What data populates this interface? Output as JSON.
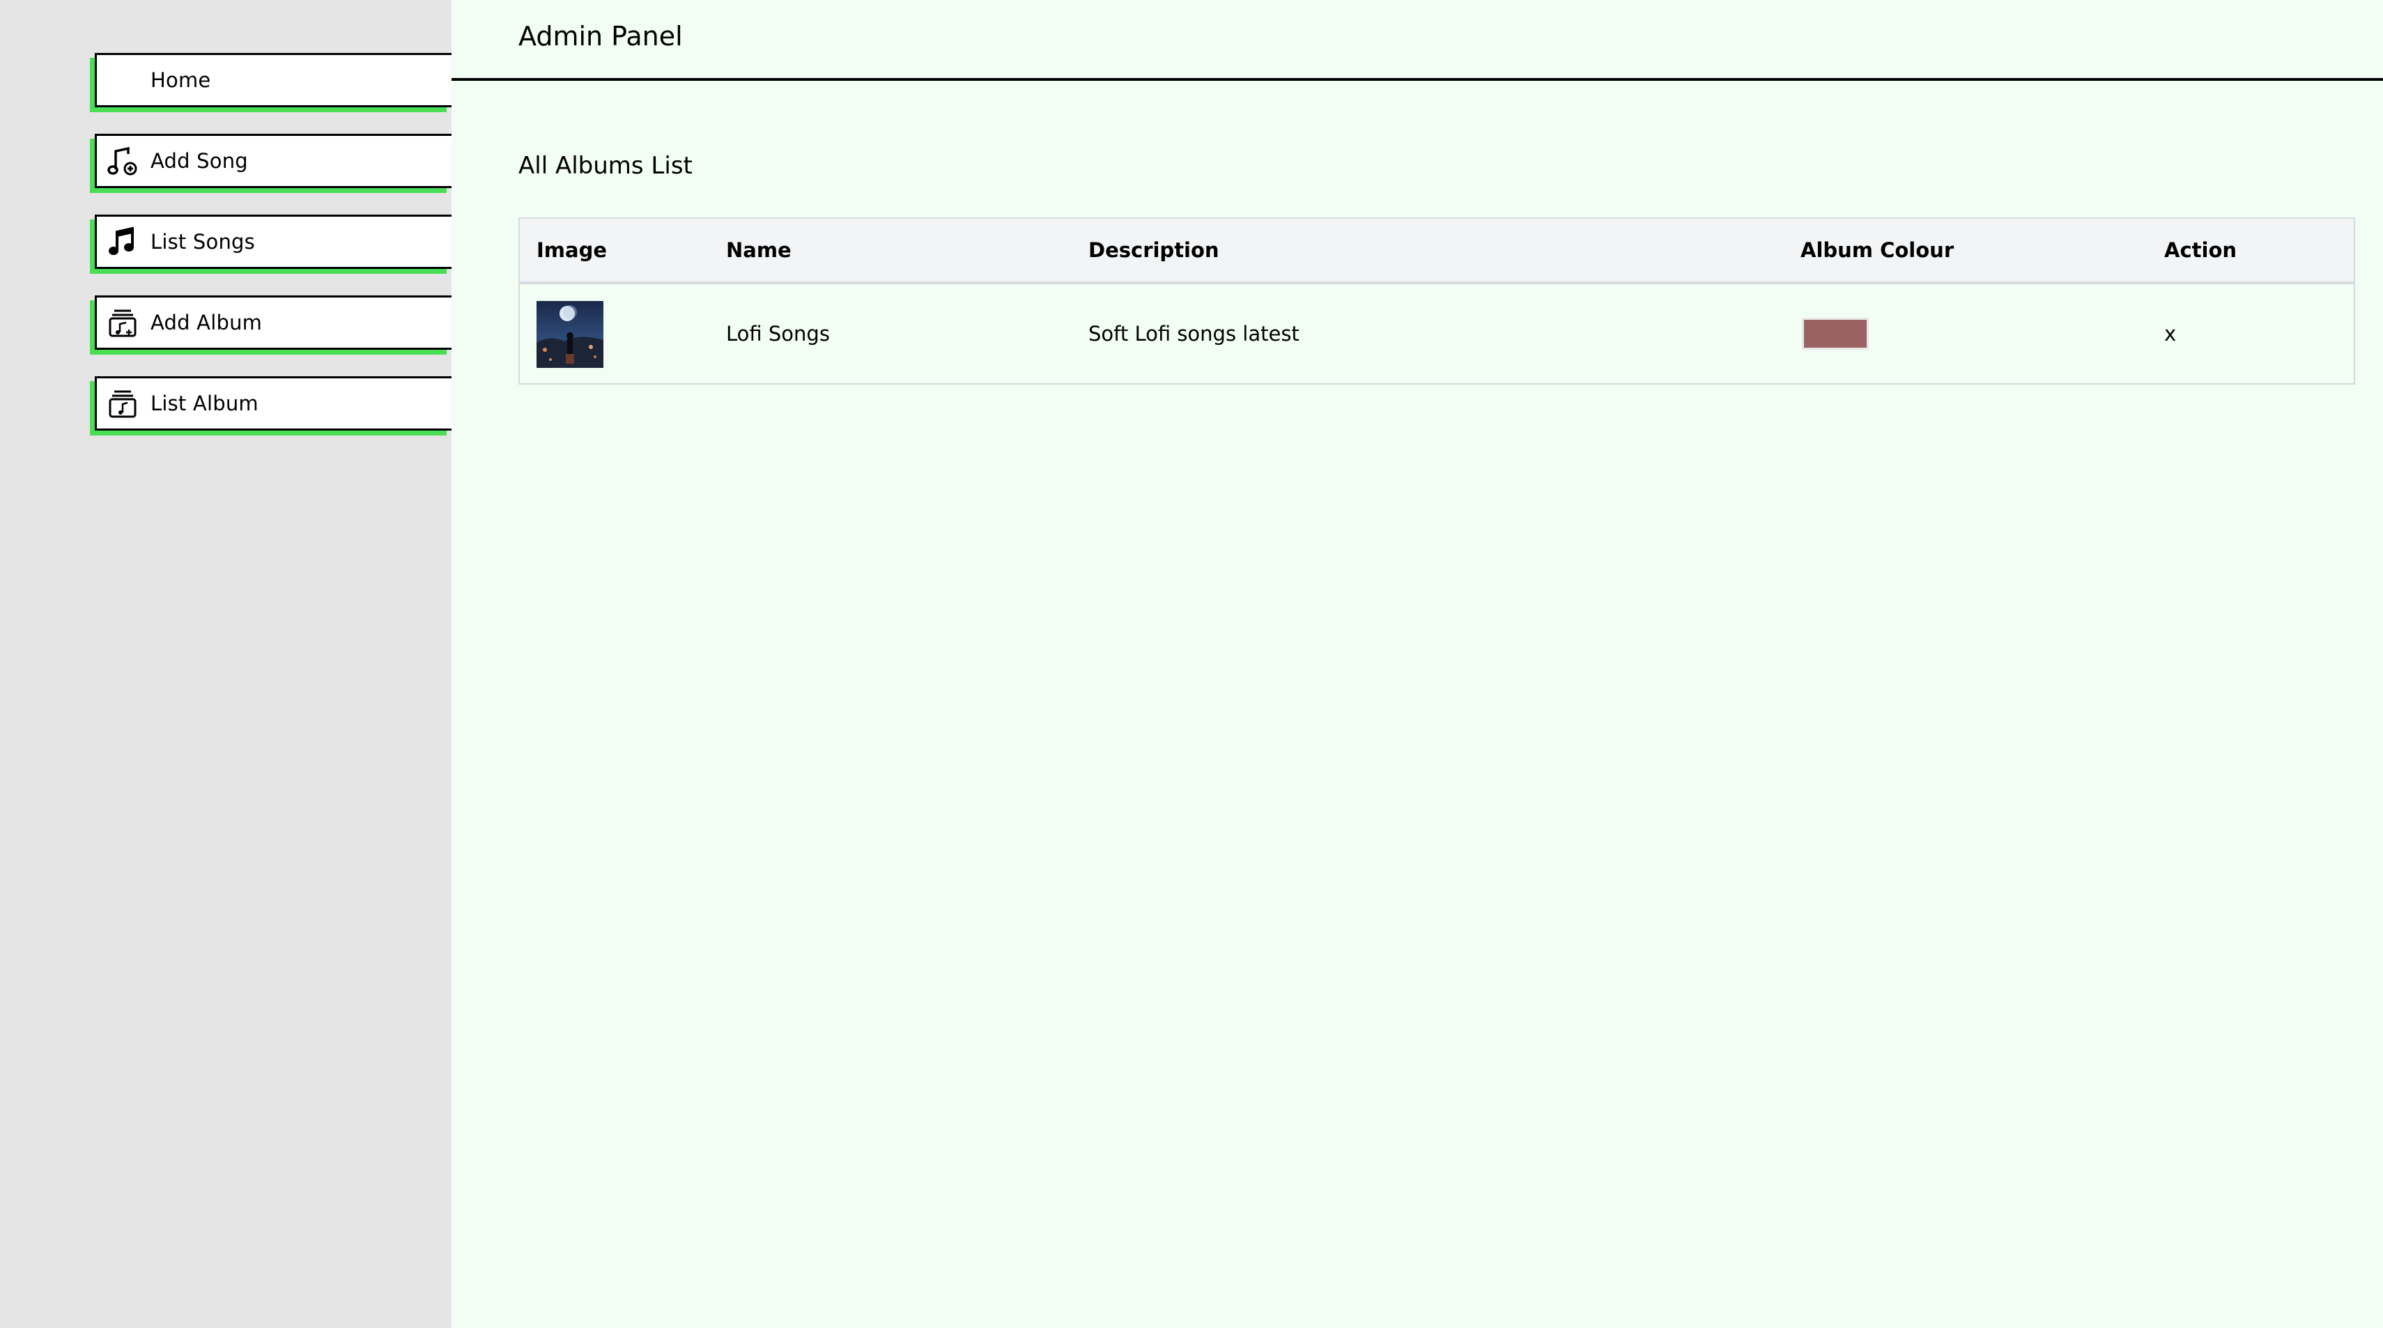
{
  "header": {
    "title": "Admin Panel"
  },
  "sidebar": {
    "items": [
      {
        "label": "Home",
        "icon": "none"
      },
      {
        "label": "Add Song",
        "icon": "music-note-add-icon"
      },
      {
        "label": "List Songs",
        "icon": "music-note-icon"
      },
      {
        "label": "Add Album",
        "icon": "album-add-icon"
      },
      {
        "label": "List Album",
        "icon": "album-list-icon"
      }
    ],
    "accent_color": "#4ade55"
  },
  "main": {
    "section_title": "All Albums List",
    "table": {
      "columns": [
        "Image",
        "Name",
        "Description",
        "Album Colour",
        "Action"
      ],
      "rows": [
        {
          "name": "Lofi Songs",
          "description": "Soft Lofi songs latest",
          "album_colour": "#9a6262",
          "action": "x"
        }
      ]
    }
  }
}
